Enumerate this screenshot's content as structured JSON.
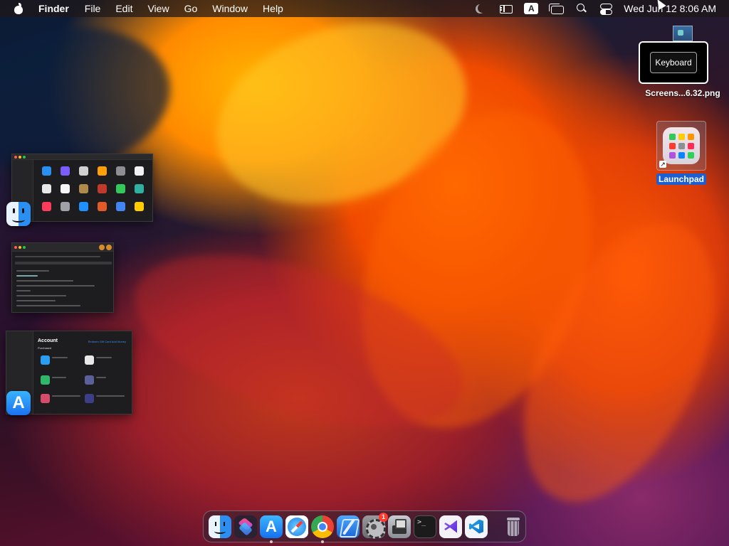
{
  "menubar": {
    "app_name": "Finder",
    "menus": [
      "File",
      "Edit",
      "View",
      "Go",
      "Window",
      "Help"
    ],
    "input_source_label": "A",
    "datetime": "Wed Jun 12  8:06 AM",
    "status_icons": [
      "focus-moon-icon",
      "stage-manager-icon",
      "input-source-icon",
      "screen-mirroring-icon",
      "spotlight-search-icon",
      "control-center-icon"
    ]
  },
  "desktop": {
    "screenshot_file": {
      "label": "Screens...6.32.png",
      "tooltip": "Keyboard"
    },
    "launchpad": {
      "label": "Launchpad",
      "dot_colors": [
        "#34c759",
        "#ffcc00",
        "#ff9500",
        "#ff3b30",
        "#8e8e93",
        "#ff2d55",
        "#af52de",
        "#0a84ff",
        "#30d158"
      ]
    }
  },
  "stage_manager": {
    "windows": [
      {
        "app_icon": "finder-icon"
      },
      {
        "app_icon": "none"
      },
      {
        "app_icon": "app-store-icon",
        "title": "Account",
        "subtitle": "Purchased",
        "link": "Redeem Gift Card   Add Money"
      }
    ]
  },
  "dock": {
    "items": [
      {
        "name": "Finder",
        "running": true
      },
      {
        "name": "Shortcuts",
        "running": false
      },
      {
        "name": "App Store",
        "running": true
      },
      {
        "name": "Safari",
        "running": false
      },
      {
        "name": "Google Chrome",
        "running": true
      },
      {
        "name": "Xcode",
        "running": false
      },
      {
        "name": "System Settings",
        "running": false,
        "badge": "1"
      },
      {
        "name": "System Information",
        "running": false
      },
      {
        "name": "Terminal",
        "running": false,
        "glyph": ">_"
      },
      {
        "name": "Visual Studio",
        "running": false
      },
      {
        "name": "Visual Studio Code",
        "running": false
      },
      {
        "name": "Trash",
        "running": false
      }
    ]
  }
}
